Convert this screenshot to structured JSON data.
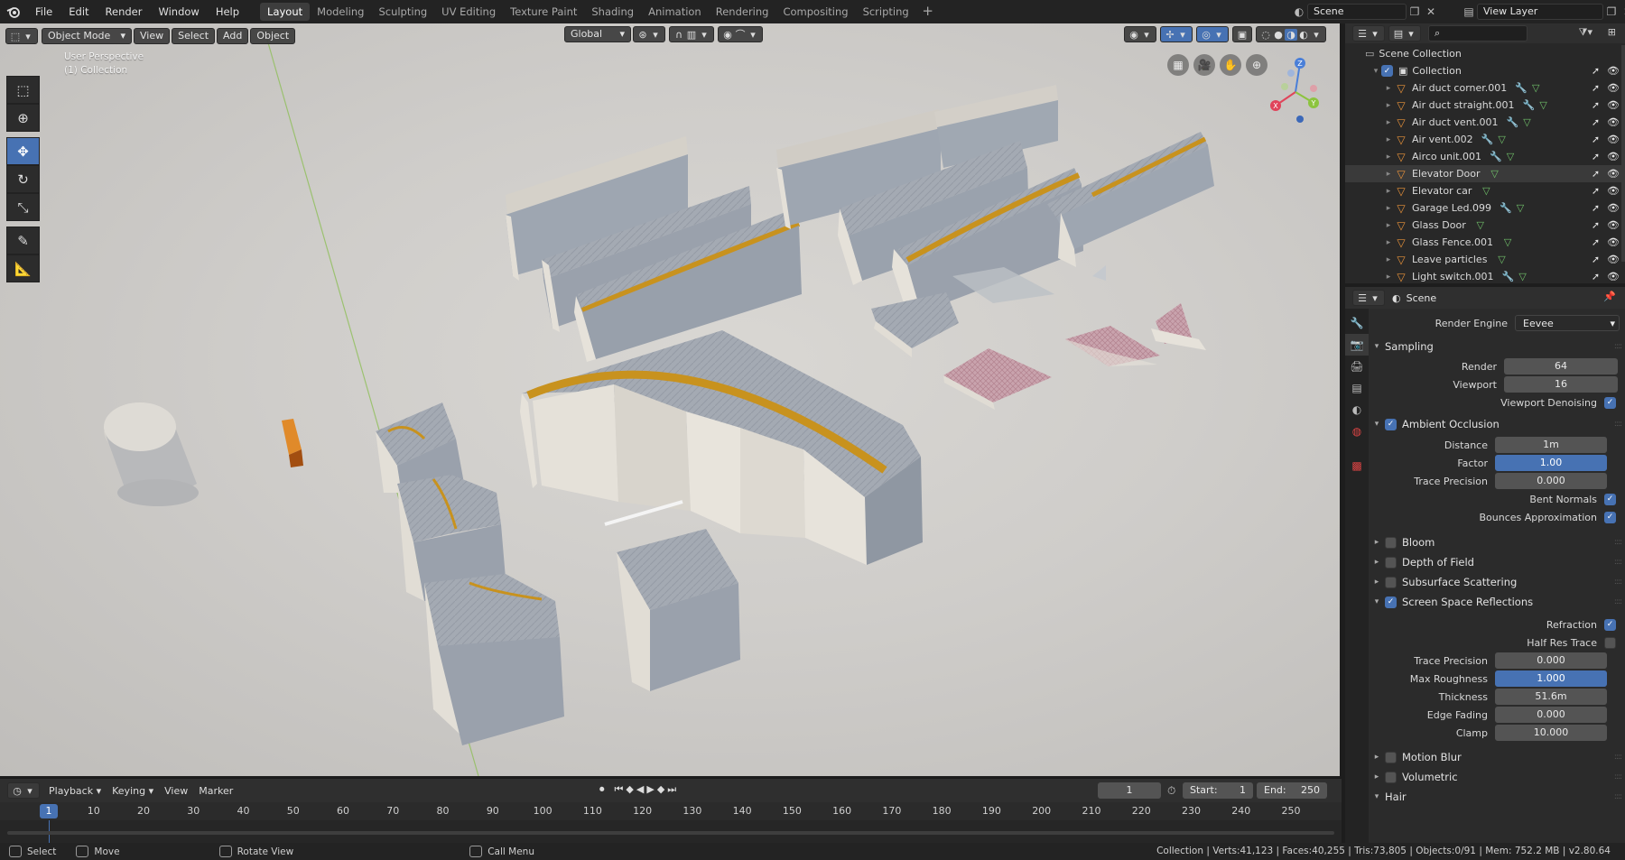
{
  "topbar": {
    "menus": [
      "File",
      "Edit",
      "Render",
      "Window",
      "Help"
    ],
    "workspaces": [
      "Layout",
      "Modeling",
      "Sculpting",
      "UV Editing",
      "Texture Paint",
      "Shading",
      "Animation",
      "Rendering",
      "Compositing",
      "Scripting"
    ],
    "active_workspace": "Layout",
    "scene_name": "Scene",
    "view_layer": "View Layer"
  },
  "viewport": {
    "mode": "Object Mode",
    "menus": [
      "View",
      "Select",
      "Add",
      "Object"
    ],
    "orientation": "Global",
    "overlay_line1": "User Perspective",
    "overlay_line2": "(1) Collection",
    "gizmo_axes": {
      "x": "X",
      "y": "Y",
      "z": "Z"
    }
  },
  "timeline": {
    "menus": [
      "Playback",
      "Keying",
      "View",
      "Marker"
    ],
    "current_frame": "1",
    "start_label": "Start:",
    "start": "1",
    "end_label": "End:",
    "end": "250",
    "ticks": [
      "1",
      "10",
      "20",
      "30",
      "40",
      "50",
      "60",
      "70",
      "80",
      "90",
      "100",
      "110",
      "120",
      "130",
      "140",
      "150",
      "160",
      "170",
      "180",
      "190",
      "200",
      "210",
      "220",
      "230",
      "240",
      "250"
    ]
  },
  "statusbar": {
    "select": "Select",
    "move": "Move",
    "rotate": "Rotate View",
    "menu": "Call Menu",
    "stats": "Collection | Verts:41,123 | Faces:40,255 | Tris:73,805 | Objects:0/91 | Mem: 752.2 MB | v2.80.64"
  },
  "outliner": {
    "root": "Scene Collection",
    "collection": "Collection",
    "items": [
      {
        "name": "Air duct corner.001",
        "mod": true
      },
      {
        "name": "Air duct straight.001",
        "mod": true
      },
      {
        "name": "Air duct vent.001",
        "mod": true
      },
      {
        "name": "Air vent.002",
        "mod": true
      },
      {
        "name": "Airco unit.001",
        "mod": true
      },
      {
        "name": "Elevator Door",
        "mod": false
      },
      {
        "name": "Elevator car",
        "mod": false
      },
      {
        "name": "Garage Led.099",
        "mod": true
      },
      {
        "name": "Glass Door",
        "mod": false
      },
      {
        "name": "Glass Fence.001",
        "mod": false
      },
      {
        "name": "Leave particles",
        "mod": false
      },
      {
        "name": "Light switch.001",
        "mod": true
      }
    ]
  },
  "properties": {
    "context": "Scene",
    "render_engine_label": "Render Engine",
    "render_engine": "Eevee",
    "sampling": {
      "title": "Sampling",
      "render_label": "Render",
      "render": "64",
      "viewport_label": "Viewport",
      "viewport": "16",
      "denoise_label": "Viewport Denoising"
    },
    "ao": {
      "title": "Ambient Occlusion",
      "distance_label": "Distance",
      "distance": "1m",
      "factor_label": "Factor",
      "factor": "1.00",
      "trace_label": "Trace Precision",
      "trace": "0.000",
      "bent_label": "Bent Normals",
      "bounces_label": "Bounces Approximation"
    },
    "bloom": "Bloom",
    "dof": "Depth of Field",
    "sss": "Subsurface Scattering",
    "ssr": {
      "title": "Screen Space Reflections",
      "refraction_label": "Refraction",
      "halfres_label": "Half Res Trace",
      "trace_label": "Trace Precision",
      "trace": "0.000",
      "roughness_label": "Max Roughness",
      "roughness": "1.000",
      "thickness_label": "Thickness",
      "thickness": "51.6m",
      "fading_label": "Edge Fading",
      "fading": "0.000",
      "clamp_label": "Clamp",
      "clamp": "10.000"
    },
    "motion_blur": "Motion Blur",
    "volumetric": "Volumetric",
    "hair": "Hair"
  }
}
